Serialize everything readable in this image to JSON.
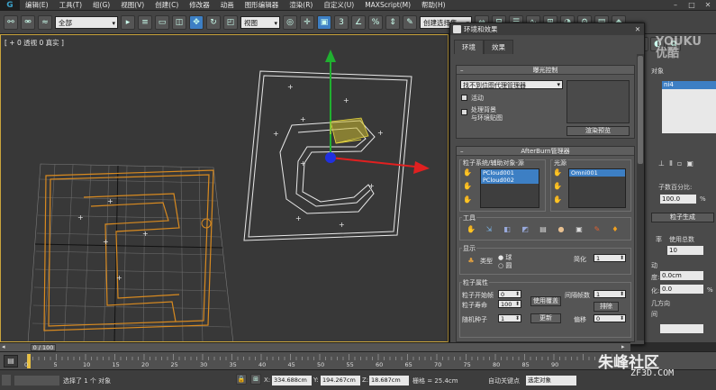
{
  "menu": {
    "logo": "G",
    "items": [
      "编辑(E)",
      "工具(T)",
      "组(G)",
      "视图(V)",
      "创建(C)",
      "修改器",
      "动画",
      "图形编辑器",
      "渲染(R)",
      "自定义(U)",
      "MAXScript(M)",
      "帮助(H)"
    ],
    "window_buttons": [
      "–",
      "□",
      "✕"
    ]
  },
  "toolbar": {
    "selection_filter": "全部",
    "ref_coord": "视图",
    "named_selection": "创建选择集"
  },
  "viewport": {
    "label": "[ + 0 透视 0 真实 ]"
  },
  "dialog": {
    "title": "环境和效果",
    "close": "✕",
    "tabs": [
      "环境",
      "效果"
    ],
    "exposure": {
      "header": "曝光控制",
      "dropdown": "找不到位图代理管理器",
      "active_label": "活动",
      "process_bg_label": "处理背景",
      "env_map_label": "与环境贴图",
      "render_preview": "渲染预览"
    },
    "afterburn": {
      "header": "AfterBurn管理器",
      "particles_label": "粒子系统/辅助对象-源",
      "lights_label": "光源",
      "particle_items": [
        "PCloud001",
        "PCloud002"
      ],
      "light_items": [
        "Omni001"
      ],
      "tools_label": "工具",
      "display_label": "显示",
      "type_label": "类型",
      "type_opt1": "球",
      "type_opt2": "圆",
      "simplify_label": "简化",
      "simplify_value": "1",
      "particle_props_label": "粒子属性",
      "start_frame_label": "粒子开始帧",
      "start_frame_value": "0",
      "life_label": "粒子寿命",
      "life_value": "100",
      "use_override": "使用覆盖",
      "stop_frame_label": "间隔帧数",
      "stop_frame_value": "1",
      "exclude": "排除",
      "seed_label": "随机种子",
      "seed_value": "1",
      "update": "更新",
      "offset_label": "偏移",
      "offset_value": "0"
    }
  },
  "cmd_panel": {
    "list_selected": "ni4",
    "label1": "对象",
    "percent_label": "子数百分比:",
    "percent_value": "100.0",
    "percent_unit": "%",
    "gen_button": "粒子生成",
    "rate_label": "率",
    "use_total": "使用总数",
    "rate_value": "10",
    "motion_label": "动",
    "speed_label": "度:",
    "speed_value": "0.0cm",
    "var_label": "化:",
    "var_value": "0.0",
    "var_unit": "%",
    "dir_label": "几方向",
    "time_label": "间"
  },
  "timeline": {
    "handle": "0 / 100",
    "ticks": [
      "0",
      "5",
      "10",
      "15",
      "20",
      "25",
      "30",
      "35",
      "40",
      "45",
      "50",
      "55",
      "60",
      "65",
      "70",
      "75",
      "80",
      "85",
      "90"
    ]
  },
  "status": {
    "message": "选择了 1 个 对象",
    "x_label": "X:",
    "x_value": "334.688cm",
    "y_label": "Y:",
    "y_value": "194.267cm",
    "z_label": "Z:",
    "z_value": "18.687cm",
    "grid_label": "栅格 = 25.4cm",
    "auto_key": "自动关键点",
    "selected_obj": "选定对象"
  },
  "watermark": {
    "youku": "YOUKU",
    "youku_cn": "优酷",
    "zf": "朱峰社区",
    "zf_url": "ZF3D.COM"
  },
  "colors": {
    "accent": "#3d7fc4",
    "orange_wire": "#d88a20",
    "axis_red": "#e02020",
    "axis_green": "#20b030",
    "axis_blue": "#2030e0"
  }
}
